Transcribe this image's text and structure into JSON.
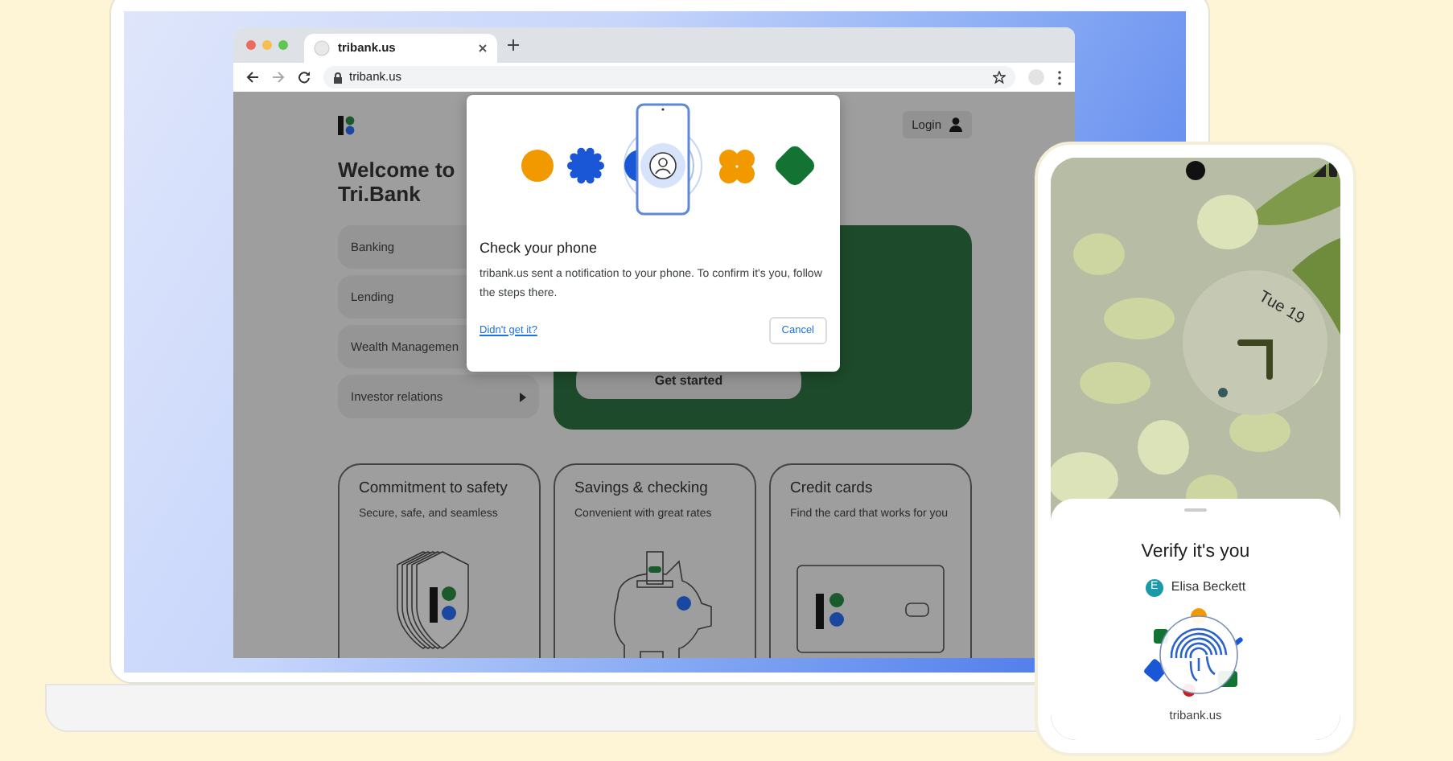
{
  "browser": {
    "tab_title": "tribank.us",
    "url": "tribank.us"
  },
  "site": {
    "login": "Login",
    "heading": "Welcome to Tri.Bank",
    "nav": [
      {
        "kind": "link",
        "label": "Banking"
      },
      {
        "kind": "link",
        "label": "Lending"
      },
      {
        "kind": "link",
        "label": "Wealth Managemen"
      },
      {
        "kind": "submenu",
        "label": "Investor relations"
      }
    ],
    "hero_button": "Get started",
    "cards": [
      {
        "kind": "shield",
        "title": "Commitment to safety",
        "subtitle": "Secure, safe, and seamless"
      },
      {
        "kind": "piggy",
        "title": "Savings & checking",
        "subtitle": "Convenient with great rates"
      },
      {
        "kind": "card",
        "title": "Credit cards",
        "subtitle": "Find the card that works for you"
      }
    ]
  },
  "dialog": {
    "title": "Check your phone",
    "body": "tribank.us sent a notification to your phone. To confirm it's you, follow the steps there.",
    "link": "Didn't get it?",
    "button": "Cancel"
  },
  "phone": {
    "date": "Tue 19",
    "sheet_title": "Verify it's you",
    "account_initial": "E",
    "account_name": "Elisa Beckett",
    "site": "tribank.us"
  }
}
